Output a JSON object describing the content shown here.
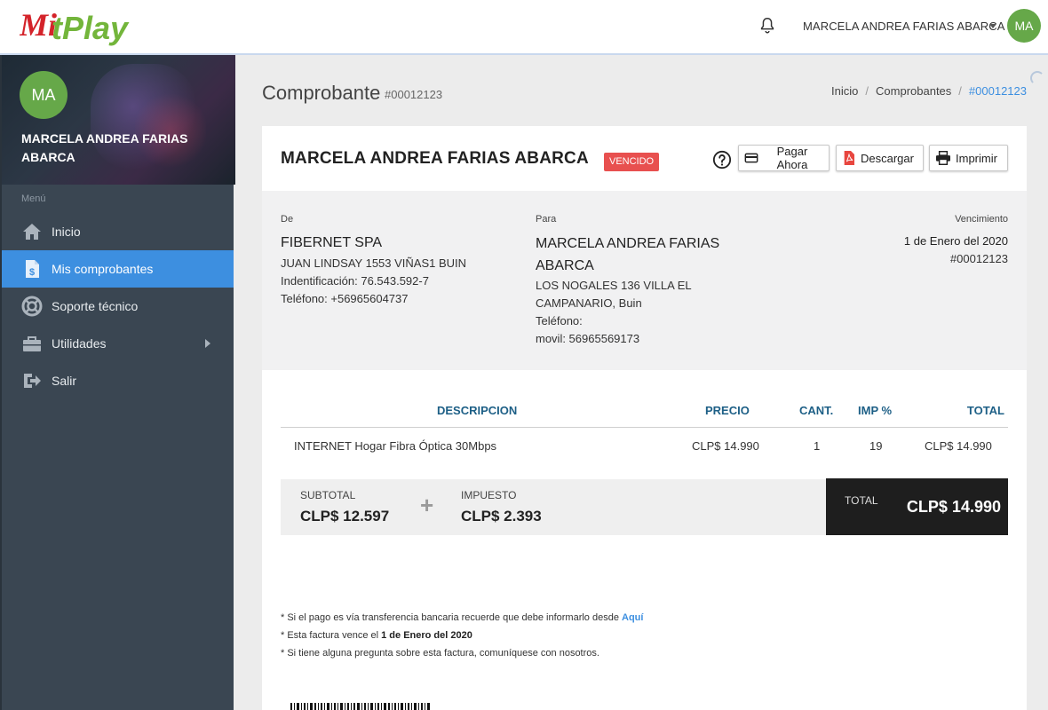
{
  "header": {
    "logo_text": "MitPlay",
    "user_name": "MARCELA ANDREA FARIAS ABARCA",
    "avatar_initials": "MA"
  },
  "sidebar": {
    "avatar_initials": "MA",
    "user_name": "MARCELA ANDREA FARIAS ABARCA",
    "menu_title": "Menú",
    "items": [
      {
        "label": "Inicio",
        "icon": "home-icon"
      },
      {
        "label": "Mis comprobantes",
        "icon": "invoice-icon"
      },
      {
        "label": "Soporte técnico",
        "icon": "lifebuoy-icon"
      },
      {
        "label": "Utilidades",
        "icon": "toolbox-icon"
      },
      {
        "label": "Salir",
        "icon": "logout-icon"
      }
    ]
  },
  "page": {
    "title": "Comprobante",
    "number": "#00012123",
    "breadcrumb": [
      "Inicio",
      "Comprobantes",
      "#00012123"
    ]
  },
  "invoice": {
    "client_name": "MARCELA ANDREA FARIAS ABARCA",
    "status": "VENCIDO",
    "buttons": {
      "pay": "Pagar Ahora",
      "download": "Descargar",
      "print": "Imprimir"
    },
    "from": {
      "label": "De",
      "name": "FIBERNET SPA",
      "address": "JUAN LINDSAY 1553 VIÑAS1 BUIN",
      "id": "Indentificación: 76.543.592-7",
      "phone": "Teléfono: +56965604737"
    },
    "to": {
      "label": "Para",
      "name": "MARCELA ANDREA FARIAS ABARCA",
      "address_1": "LOS NOGALES 136 VILLA EL",
      "address_2": "CAMPANARIO, Buin",
      "phone": "Teléfono:",
      "mobile": "movil: 56965569173"
    },
    "due": {
      "label": "Vencimiento",
      "date": "1 de Enero del 2020",
      "number": "#00012123"
    },
    "table": {
      "headers": {
        "description": "DESCRIPCION",
        "price": "PRECIO",
        "qty": "CANT.",
        "tax": "IMP %",
        "total": "TOTAL"
      },
      "rows": [
        {
          "description": "INTERNET Hogar Fibra Óptica 30Mbps",
          "price": "CLP$ 14.990",
          "qty": "1",
          "tax": "19",
          "total": "CLP$ 14.990"
        }
      ]
    },
    "totals": {
      "subtotal_label": "SUBTOTAL",
      "subtotal": "CLP$ 12.597",
      "plus": "+",
      "tax_label": "IMPUESTO",
      "tax": "CLP$ 2.393",
      "total_label": "TOTAL",
      "total": "CLP$ 14.990"
    },
    "notes": {
      "n1_text": "* Si el pago es vía transferencia bancaria recuerde que debe informarlo desde ",
      "n1_link": "Aquí",
      "n2_text": "* Esta factura vence el ",
      "n2_bold": "1 de Enero del 2020",
      "n3_text": "* Si tiene alguna pregunta sobre esta factura, comuníquese con nosotros."
    }
  },
  "colors": {
    "accent": "#3d8fe0",
    "sidebar_bg": "#3a4652",
    "status_badge": "#e8504f",
    "avatar": "#66a849",
    "table_header_text": "#1d5f86",
    "grand_total_bg": "#1e1e1e"
  }
}
